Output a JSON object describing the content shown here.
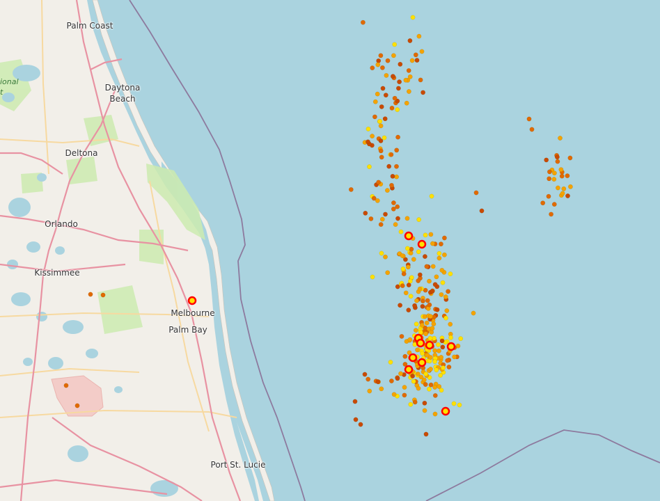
{
  "map": {
    "cities": [
      {
        "key": "palm_coast",
        "label": "Palm Coast"
      },
      {
        "key": "daytona_a",
        "label": "Daytona"
      },
      {
        "key": "daytona_b",
        "label": "Beach"
      },
      {
        "key": "deltona",
        "label": "Deltona"
      },
      {
        "key": "orlando",
        "label": "Orlando"
      },
      {
        "key": "kissimmee",
        "label": "Kissimmee"
      },
      {
        "key": "melbourne",
        "label": "Melbourne"
      },
      {
        "key": "palm_bay",
        "label": "Palm Bay"
      },
      {
        "key": "port_st_lucie",
        "label": "Port St. Lucie"
      }
    ],
    "park_label_a": "ional",
    "park_label_b": "t",
    "colors": {
      "water": "#aad3df",
      "land": "#f2efe9",
      "major_road": "#e892a2",
      "secondary_road": "#f7d9a0",
      "boundary": "#8d7a9e",
      "strike_recent": "#ffe000",
      "strike_mid": "#f4a300",
      "strike_older": "#e06a00",
      "strike_oldest": "#c84a00",
      "strike_new_ring": "#ff0000"
    }
  }
}
